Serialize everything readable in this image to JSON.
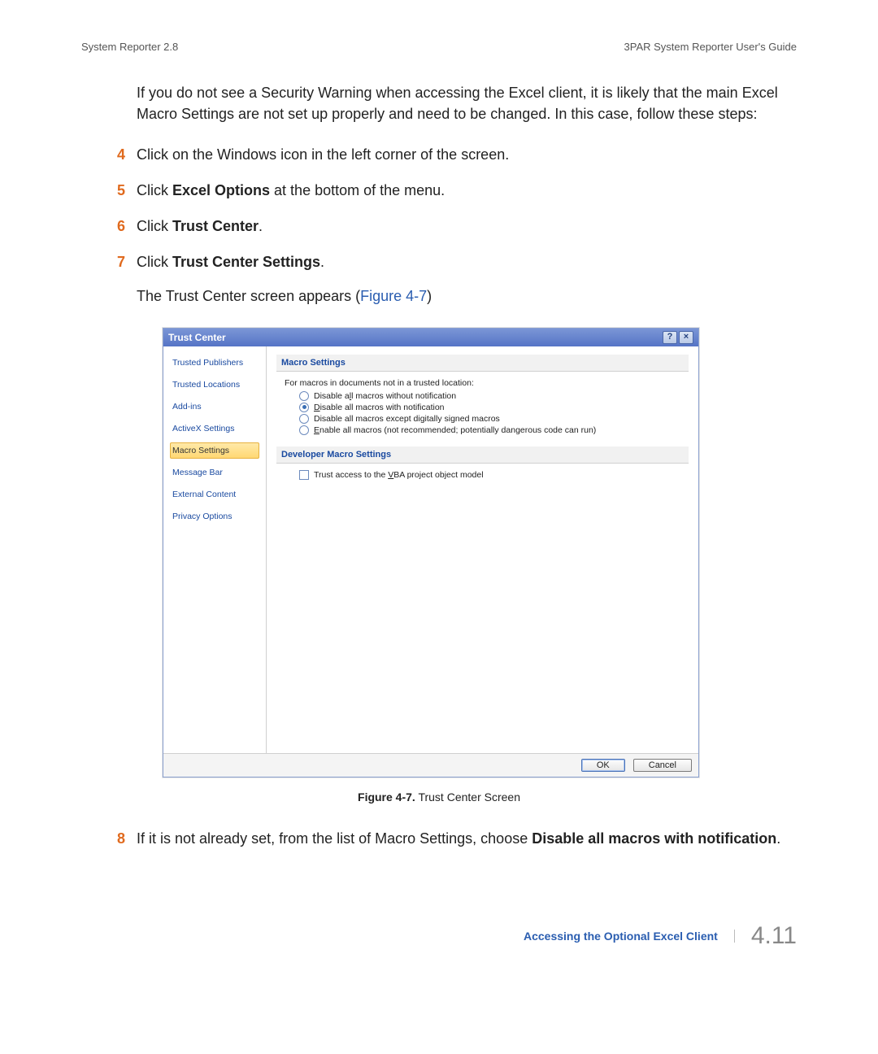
{
  "header": {
    "left": "System Reporter 2.8",
    "right": "3PAR System Reporter User's Guide"
  },
  "intro": "If you do not see a Security Warning when accessing the Excel client, it is likely that the main Excel Macro Settings are not set up properly and need to be changed. In this case, follow these steps:",
  "steps": {
    "s4": {
      "num": "4",
      "text_before": "Click on the Windows icon in the left corner of the screen."
    },
    "s5": {
      "num": "5",
      "text_before": "Click ",
      "bold": "Excel Options",
      "text_after": " at the bottom of the menu."
    },
    "s6": {
      "num": "6",
      "text_before": "Click ",
      "bold": "Trust Center",
      "text_after": "."
    },
    "s7": {
      "num": "7",
      "text_before": "Click ",
      "bold": "Trust Center Settings",
      "text_after": "."
    },
    "s8": {
      "num": "8",
      "text_before": "If it is not already set, from the list of Macro Settings, choose ",
      "bold": "Disable all macros with notification",
      "text_after": "."
    }
  },
  "subtext": {
    "before": "The Trust Center screen appears (",
    "figref": "Figure 4-7",
    "after": ")"
  },
  "trust_center": {
    "title": "Trust Center",
    "help_btn": "?",
    "close_btn": "×",
    "sidebar": {
      "items": [
        "Trusted Publishers",
        "Trusted Locations",
        "Add-ins",
        "ActiveX Settings",
        "Macro Settings",
        "Message Bar",
        "External Content",
        "Privacy Options"
      ],
      "selected_index": 4
    },
    "section1_title": "Macro Settings",
    "section1_intro": "For macros in documents not in a trusted location:",
    "radios": [
      {
        "pre": "Disable a",
        "ul": "l",
        "post": "l macros without notification",
        "checked": false
      },
      {
        "pre": "",
        "ul": "D",
        "post": "isable all macros with notification",
        "checked": true
      },
      {
        "pre": "Disable all macros except digitally si",
        "ul": "g",
        "post": "ned macros",
        "checked": false
      },
      {
        "pre": "",
        "ul": "E",
        "post": "nable all macros (not recommended; potentially dangerous code can run)",
        "checked": false
      }
    ],
    "section2_title": "Developer Macro Settings",
    "checkbox": {
      "pre": "Trust access to the ",
      "ul": "V",
      "post": "BA project object model",
      "checked": false
    },
    "ok": "OK",
    "cancel": "Cancel"
  },
  "figure_caption": {
    "label": "Figure 4-7.",
    "text": "  Trust Center Screen"
  },
  "footer": {
    "link": "Accessing the Optional Excel Client",
    "pagenum": "4.11"
  }
}
